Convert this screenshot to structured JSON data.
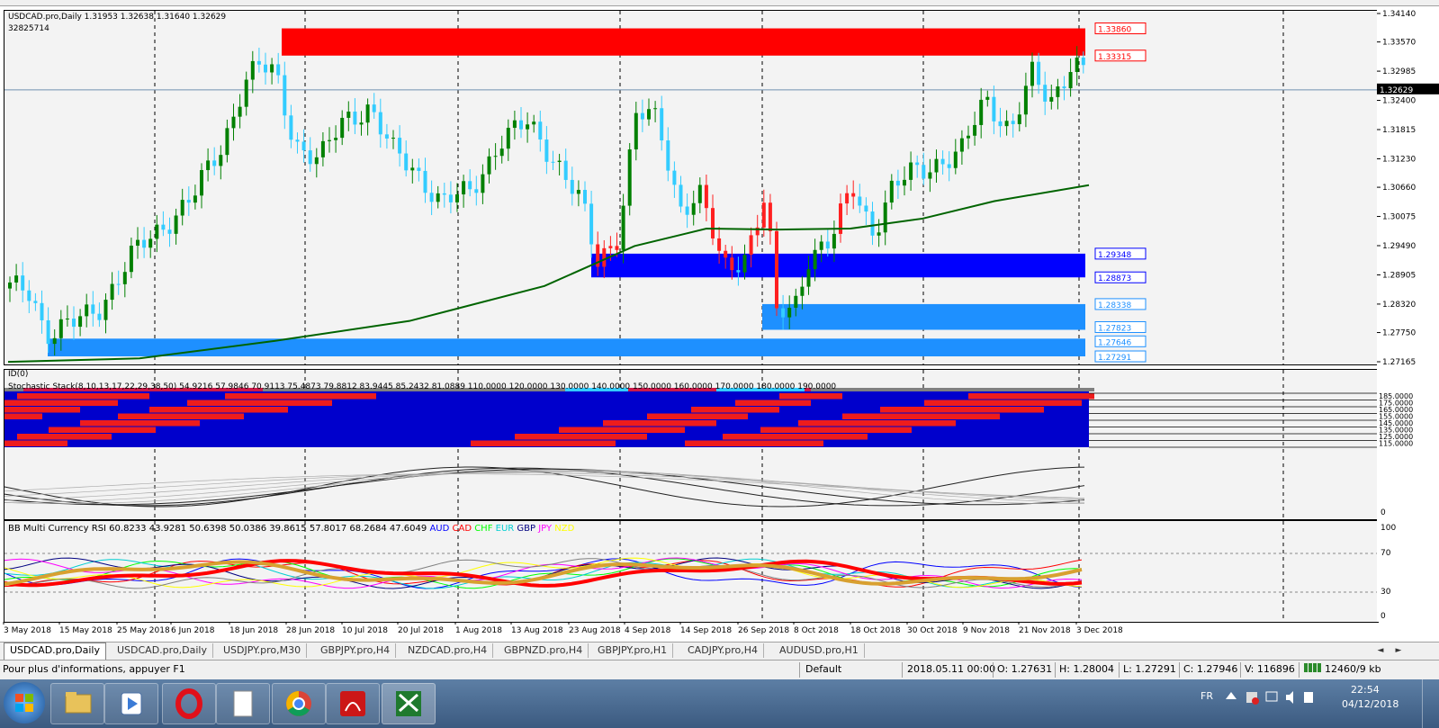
{
  "main_chart": {
    "symbol_info": "USDCAD.pro,Daily  1.31953 1.32638 1.31640 1.32629",
    "indicator_value": "32825714",
    "price_ticks": [
      "1.34140",
      "1.33570",
      "1.32985",
      "1.32629",
      "1.32400",
      "1.31815",
      "1.31230",
      "1.30660",
      "1.30075",
      "1.29490",
      "1.28905",
      "1.28320",
      "1.27750",
      "1.27165"
    ],
    "zone_labels": {
      "red_top": "1.33860",
      "red_bottom": "1.33315",
      "blue_top": "1.29348",
      "blue_bottom": "1.28873",
      "light1_top": "1.28338",
      "light1_bottom": "1.27823",
      "light2_top": "1.27646",
      "light2_bottom": "1.27291"
    },
    "colors": {
      "bull": "#008000",
      "bear": "#33ccff",
      "ma": "#006400",
      "red_zone": "#ff0000",
      "blue_zone": "#0000ff",
      "light_zone": "#1e90ff"
    }
  },
  "stoch_pane": {
    "id_label": "ID(0)",
    "title": "Stochastic Stack(8,10,13,17,22,29,38,50) 54.9216 57.9846 70.9113 75.4873 79.8812 83.9445 85.2432 81.0889 110.0000 120.0000 130.0000 140.0000 150.0000 160.0000 170.0000 180.0000 190.0000",
    "level_ticks": [
      "185.0000",
      "175.0000",
      "165.0000",
      "155.0000",
      "145.0000",
      "135.0000",
      "125.0000",
      "115.0000"
    ],
    "bottom_tick": "0"
  },
  "rsi_pane": {
    "title": "BB Multi Currency RSI 60.8233 43.9281 50.6398 50.0386 39.8615 57.8017 68.2684 47.6049",
    "currencies": [
      {
        "name": "AUD",
        "color": "#0000ff"
      },
      {
        "name": "CAD",
        "color": "#ff0000"
      },
      {
        "name": "CHF",
        "color": "#00ff00"
      },
      {
        "name": "EUR",
        "color": "#00ced1"
      },
      {
        "name": "GBP",
        "color": "#000080"
      },
      {
        "name": "JPY",
        "color": "#ff00ff"
      },
      {
        "name": "NZD",
        "color": "#ffff00"
      }
    ],
    "ticks": [
      "100",
      "70",
      "30",
      "0"
    ]
  },
  "date_axis": [
    "3 May 2018",
    "15 May 2018",
    "25 May 2018",
    "6 Jun 2018",
    "18 Jun 2018",
    "28 Jun 2018",
    "10 Jul 2018",
    "20 Jul 2018",
    "1 Aug 2018",
    "13 Aug 2018",
    "23 Aug 2018",
    "4 Sep 2018",
    "14 Sep 2018",
    "26 Sep 2018",
    "8 Oct 2018",
    "18 Oct 2018",
    "30 Oct 2018",
    "9 Nov 2018",
    "21 Nov 2018",
    "3 Dec 2018"
  ],
  "tabs": [
    "USDCAD.pro,Daily",
    "USDCAD.pro,Daily",
    "USDJPY.pro,M30",
    "GBPJPY.pro,H4",
    "NZDCAD.pro,H4",
    "GBPNZD.pro,H4",
    "GBPJPY.pro,H1",
    "CADJPY.pro,H4",
    "AUDUSD.pro,H1"
  ],
  "status": {
    "help": "Pour plus d'informations, appuyer F1",
    "profile": "Default",
    "datetime": "2018.05.11 00:00",
    "open": "O: 1.27631",
    "high": "H: 1.28004",
    "low": "L: 1.27291",
    "close": "C: 1.27946",
    "volume": "V: 116896",
    "traffic": "12460/9 kb"
  },
  "taskbar": {
    "lang": "FR",
    "time": "22:54",
    "date": "04/12/2018"
  }
}
